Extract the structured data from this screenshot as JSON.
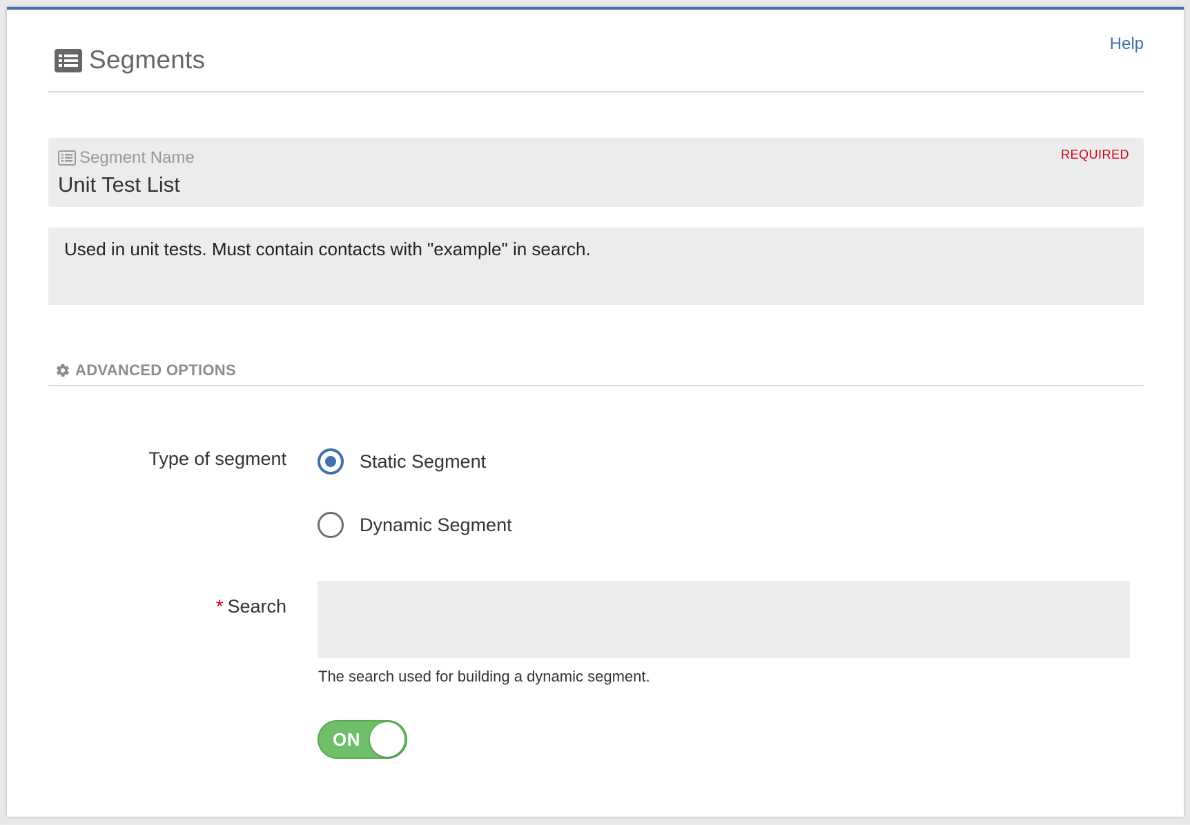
{
  "header": {
    "title": "Segments",
    "title_icon": "list-icon",
    "help_label": "Help"
  },
  "segment_name": {
    "icon": "list-icon",
    "label": "Segment Name",
    "required_label": "REQUIRED",
    "value": "Unit Test List"
  },
  "description": {
    "value": "Used in unit tests. Must contain contacts with \"example\" in search."
  },
  "advanced": {
    "icon": "gear-icon",
    "label": "ADVANCED OPTIONS"
  },
  "type_of_segment": {
    "label": "Type of segment",
    "options": [
      {
        "label": "Static Segment",
        "selected": true
      },
      {
        "label": "Dynamic Segment",
        "selected": false
      }
    ]
  },
  "search": {
    "required_marker": "*",
    "label": "Search",
    "value": "",
    "help_text": "The search used for building a dynamic segment."
  },
  "toggle": {
    "label": "ON",
    "state": true
  },
  "colors": {
    "accent": "#3d72ad",
    "required": "#d0021b",
    "toggle_on": "#6fbf6a",
    "field_bg": "#ececec"
  }
}
